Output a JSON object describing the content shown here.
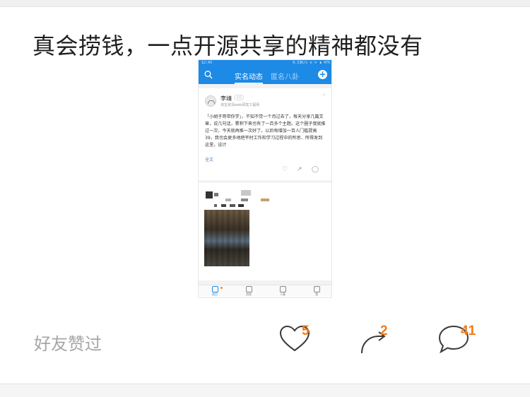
{
  "post": {
    "text": "真会捞钱，一点开源共享的精神都没有"
  },
  "embedded_screenshot": {
    "status_time": "12:43",
    "status_right": "0.13K/s ≋ ᯤ ▮ 47%",
    "tabs": [
      "实名动态",
      "匿名八卦"
    ],
    "post1": {
      "author": "李靖",
      "badge": "认证",
      "role": "淘宝资深web研发工程师",
      "body": "「小胡子哥带你学」，不知不觉一个月过去了，每天分享几篇文章，说几句话，累积下来也有了一百多个主题。这个圈子我就推过一次，今天就再推一次好了。以后每增加一百人门槛提高 39，我也会更多地把平时工作和学习过程中的所思、所得发到这里，设计",
      "more": "全文"
    },
    "bottom_tabs": [
      "首页",
      "消息",
      "人脉",
      "我"
    ]
  },
  "footer": {
    "liked_by": "好友赞过",
    "likes": "5",
    "shares": "2",
    "comments": "41"
  },
  "colors": {
    "accent": "#1d8ae5",
    "count": "#f07c19",
    "muted": "#a6a6a6"
  }
}
